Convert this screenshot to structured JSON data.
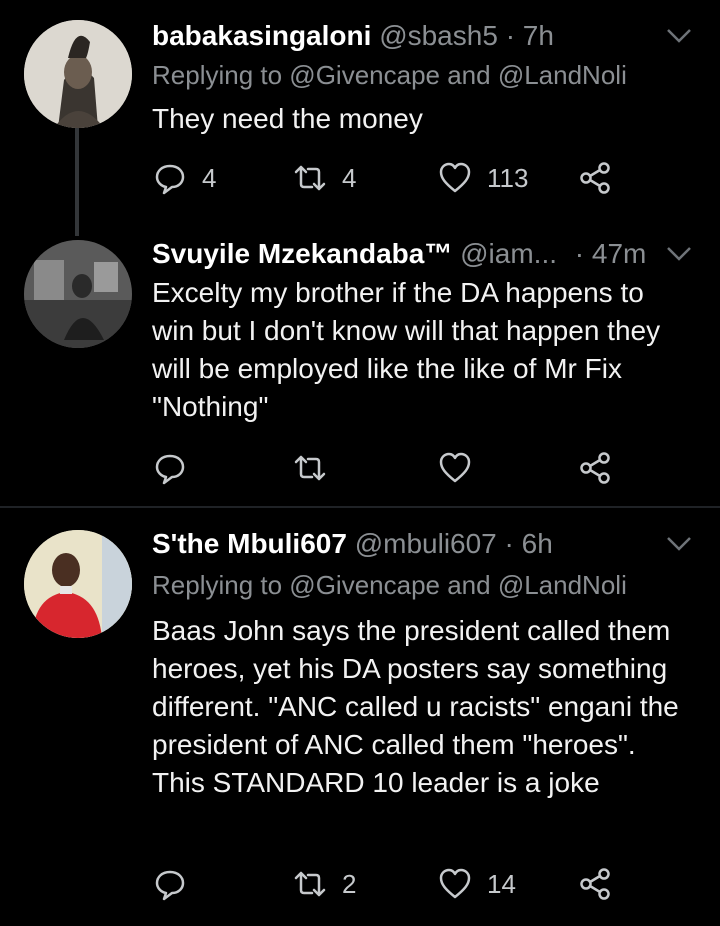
{
  "colors": {
    "background": "#000000",
    "text": "#e7e9ea",
    "muted": "#8b8f93",
    "divider": "#1f2226"
  },
  "tweets": [
    {
      "name": "babakasingaloni",
      "handle": "@sbash5",
      "dot": "·",
      "time": "7h",
      "reply_to": "Replying to @Givencape and @LandNoli",
      "body": "They need the money",
      "replies": "4",
      "retweets": "4",
      "likes": "113"
    },
    {
      "name": "Svuyile Mzekandaba™",
      "handle": "@iam...",
      "dot": "·",
      "time": "47m",
      "body": "Excelty my brother if the DA happens to win but I don't know will that happen they will be employed like the like of Mr Fix \"Nothing\"",
      "replies": "",
      "retweets": "",
      "likes": ""
    },
    {
      "name": "S'the Mbuli607",
      "handle": "@mbuli607",
      "dot": "·",
      "time": "6h",
      "reply_to": "Replying to @Givencape and @LandNoli",
      "body": "Baas John says the president called them heroes, yet his DA posters say something different. \"ANC called u racists\" engani the president of ANC called them \"heroes\". This STANDARD 10 leader is a joke",
      "replies": "",
      "retweets": "2",
      "likes": "14"
    }
  ],
  "icons": [
    "chevron-down-icon",
    "reply-icon",
    "retweet-icon",
    "like-icon",
    "share-icon"
  ]
}
